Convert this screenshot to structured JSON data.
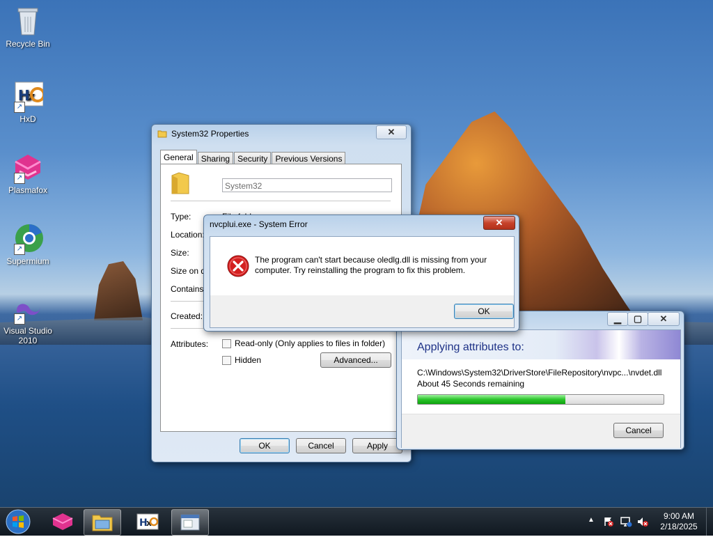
{
  "desktop": {
    "icons": [
      {
        "label": "Recycle Bin",
        "icon": "recycle-bin-icon"
      },
      {
        "label": "HxD",
        "icon": "hxd-icon"
      },
      {
        "label": "Plasmafox",
        "icon": "plasmafox-icon"
      },
      {
        "label": "Supermium",
        "icon": "supermium-icon"
      },
      {
        "label": "Visual Studio 2010",
        "icon": "visual-studio-icon"
      }
    ]
  },
  "properties": {
    "title": "System32 Properties",
    "tabs": [
      "General",
      "Sharing",
      "Security",
      "Previous Versions"
    ],
    "name_value": "System32",
    "rows": {
      "type": "Type:",
      "type_value": "File folder",
      "location": "Location:",
      "size": "Size:",
      "size_on_disk": "Size on disk:",
      "contains": "Contains:",
      "created": "Created:",
      "attributes": "Attributes:"
    },
    "readonly_label": "Read-only (Only applies to files in folder)",
    "hidden_label": "Hidden",
    "advanced_label": "Advanced...",
    "ok": "OK",
    "cancel": "Cancel",
    "apply": "Apply"
  },
  "error": {
    "title": "nvcplui.exe - System Error",
    "message": "The program can't start because oledlg.dll is missing from your computer. Try reinstalling the program to fix this problem.",
    "ok": "OK",
    "close": "✕"
  },
  "progress": {
    "heading": "Applying attributes to:",
    "path": "C:\\Windows\\System32\\DriverStore\\FileRepository\\nvpc...\\nvdet.dll",
    "remaining": "About 45 Seconds remaining",
    "percent": 60,
    "cancel": "Cancel"
  },
  "taskbar": {
    "time": "9:00 AM",
    "date": "2/18/2025"
  }
}
